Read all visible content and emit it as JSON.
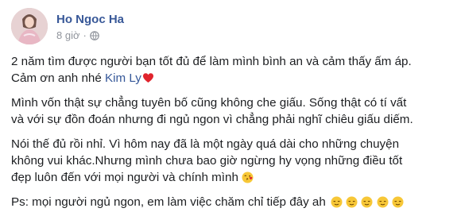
{
  "post": {
    "author": "Ho Ngoc Ha",
    "time": "8 giờ",
    "separator": "·",
    "privacy_icon": "globe-icon",
    "colors": {
      "author_link": "#385898",
      "meta_text": "#90949c",
      "body_text": "#1c1e21",
      "mention": "#365899"
    },
    "paragraphs": {
      "p1": {
        "line1": "2 năm tìm được người bạn tốt đủ để làm mình bình an và cảm thấy ấm áp.",
        "line2_prefix": "Cảm ơn anh nhé ",
        "mention": "Kim Ly",
        "emoji": "red-heart-icon"
      },
      "p2": {
        "line1": "Mình vốn thật sự chẳng tuyên bố cũng không che giấu. Sống thật có tí vất",
        "line2": "và với sự đồn đoán nhưng đi ngủ ngon vì chẳng phải nghĩ chiêu giấu diếm."
      },
      "p3": {
        "line1": "Nói thế đủ rồi nhỉ. Vì hôm nay đã là một ngày quá dài cho những chuyện",
        "line2": "không vui khác.Nhưng mình chưa bao giờ ngừng hy vọng những điều tốt",
        "line3": "đẹp luôn đến với mọi người và chính mình",
        "emoji": "face-blowing-kiss-icon"
      },
      "p4": {
        "text": "Ps: mọi người ngủ ngon, em làm việc chăm chỉ tiếp đây ah",
        "emoji": "relieved-face-icon",
        "emoji_count": 5
      }
    }
  }
}
